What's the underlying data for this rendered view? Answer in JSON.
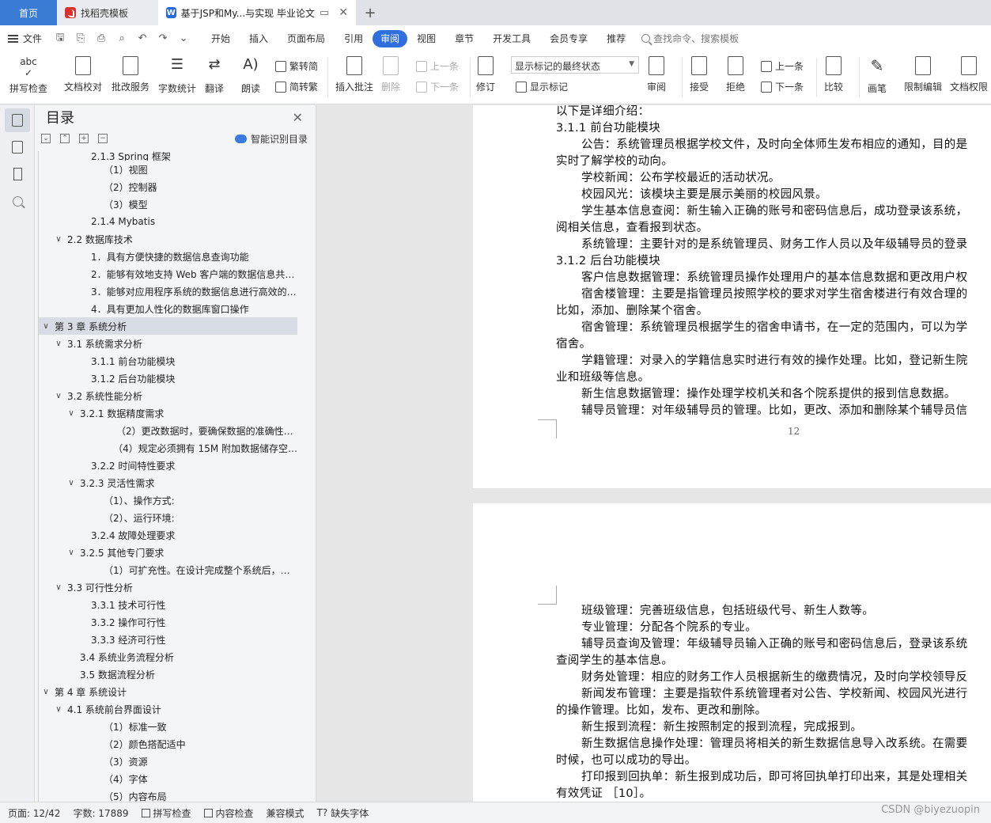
{
  "tabs": {
    "home": "首页",
    "template": "找稻壳模板",
    "document": "基于JSP和My...与实现 毕业论文"
  },
  "menu": {
    "file": "文件",
    "items": [
      "开始",
      "插入",
      "页面布局",
      "引用",
      "审阅",
      "视图",
      "章节",
      "开发工具",
      "会员专享",
      "推荐"
    ],
    "active": "审阅",
    "search": "查找命令、搜索模板"
  },
  "ribbon": {
    "spellcheck": "拼写检查",
    "proofread": "文档校对",
    "batch": "批改服务",
    "wordcount": "字数统计",
    "translate": "翻译",
    "read": "朗读",
    "to_traditional": "繁转简",
    "to_simplified": "简转繁",
    "insert_comment": "插入批注",
    "delete": "删除",
    "prev": "上一条",
    "next": "下一条",
    "revise": "修订",
    "markup_select": "显示标记的最终状态",
    "show_markup": "显示标记",
    "review": "审阅",
    "accept": "接受",
    "reject": "拒绝",
    "prev2": "上一条",
    "next2": "下一条",
    "compare": "比较",
    "pen": "画笔",
    "restrict": "限制编辑",
    "doc_perm": "文档权限"
  },
  "toc": {
    "title": "目录",
    "smart": "智能识别目录",
    "items": [
      {
        "text": "2.1.3 Spring 框架",
        "indent": 4,
        "caret": ""
      },
      {
        "text": "（1）视图",
        "indent": 5,
        "caret": ""
      },
      {
        "text": "（2）控制器",
        "indent": 5,
        "caret": ""
      },
      {
        "text": "（3）模型",
        "indent": 5,
        "caret": ""
      },
      {
        "text": "2.1.4    Mybatis",
        "indent": 4,
        "caret": ""
      },
      {
        "text": "2.2  数据库技术",
        "indent": 2,
        "caret": "v"
      },
      {
        "text": "1．具有方便快捷的数据信息查询功能",
        "indent": 4,
        "caret": ""
      },
      {
        "text": "2．能够有效地支持 Web 客户端的数据信息共…",
        "indent": 4,
        "caret": ""
      },
      {
        "text": "3．能够对应用程序系统的数据信息进行高效的…",
        "indent": 4,
        "caret": ""
      },
      {
        "text": "4．具有更加人性化的数据库窗口操作",
        "indent": 4,
        "caret": ""
      },
      {
        "text": "第 3 章    系统分析",
        "indent": 1,
        "caret": "v",
        "sel": true
      },
      {
        "text": "3.1  系统需求分析",
        "indent": 2,
        "caret": "v"
      },
      {
        "text": "3.1.1 前台功能模块",
        "indent": 4,
        "caret": ""
      },
      {
        "text": "3.1.2 后台功能模块",
        "indent": 4,
        "caret": ""
      },
      {
        "text": "3.2  系统性能分析",
        "indent": 2,
        "caret": "v"
      },
      {
        "text": "3.2.1 数据精度需求",
        "indent": 3,
        "caret": "v"
      },
      {
        "text": "（2）更改数据时，要确保数据的准确性…",
        "indent": 6,
        "caret": ""
      },
      {
        "text": "（4）规定必须拥有 15M 附加数据储存空…",
        "indent": 6,
        "caret": ""
      },
      {
        "text": "3.2.2 时间特性要求",
        "indent": 4,
        "caret": ""
      },
      {
        "text": "3.2.3 灵活性需求",
        "indent": 3,
        "caret": "v"
      },
      {
        "text": "（1）、操作方式:",
        "indent": 5,
        "caret": ""
      },
      {
        "text": "（2）、运行环境:",
        "indent": 5,
        "caret": ""
      },
      {
        "text": "3.2.4 故障处理要求",
        "indent": 4,
        "caret": ""
      },
      {
        "text": "3.2.5 其他专门要求",
        "indent": 3,
        "caret": "v"
      },
      {
        "text": "（1）可扩充性。在设计完成整个系统后，…",
        "indent": 5,
        "caret": ""
      },
      {
        "text": "3.3  可行性分析",
        "indent": 2,
        "caret": "v"
      },
      {
        "text": "3.3.1  技术可行性",
        "indent": 4,
        "caret": ""
      },
      {
        "text": "3.3.2  操作可行性",
        "indent": 4,
        "caret": ""
      },
      {
        "text": "3.3.3  经济可行性",
        "indent": 4,
        "caret": ""
      },
      {
        "text": "3.4 系统业务流程分析",
        "indent": 3,
        "caret": ""
      },
      {
        "text": "3.5 数据流程分析",
        "indent": 3,
        "caret": ""
      },
      {
        "text": "第 4 章    系统设计",
        "indent": 1,
        "caret": "v"
      },
      {
        "text": "4.1  系统前台界面设计",
        "indent": 2,
        "caret": "v"
      },
      {
        "text": "（1）标准一致",
        "indent": 5,
        "caret": ""
      },
      {
        "text": "（2）颜色搭配适中",
        "indent": 5,
        "caret": ""
      },
      {
        "text": "（3）资源",
        "indent": 5,
        "caret": ""
      },
      {
        "text": "（4）字体",
        "indent": 5,
        "caret": ""
      },
      {
        "text": "（5）内容布局",
        "indent": 5,
        "caret": ""
      }
    ]
  },
  "page1": {
    "lines": [
      {
        "t": "以下是详细介绍：",
        "ind": false
      },
      {
        "t": "3.1.1 前台功能模块",
        "ind": false
      },
      {
        "t": "公告：系统管理员根据学校文件，及时向全体师生发布相应的通知，目的是",
        "ind": true
      },
      {
        "t": "实时了解学校的动向。",
        "ind": false
      },
      {
        "t": "学校新闻：公布学校最近的活动状况。",
        "ind": true
      },
      {
        "t": "校园风光：该模块主要是展示美丽的校园风景。",
        "ind": true
      },
      {
        "t": "学生基本信息查阅：新生输入正确的账号和密码信息后，成功登录该系统，",
        "ind": true
      },
      {
        "t": "阅相关信息，查看报到状态。",
        "ind": false
      },
      {
        "t": "系统管理：主要针对的是系统管理员、财务工作人员以及年级辅导员的登录",
        "ind": true
      },
      {
        "t": "3.1.2 后台功能模块",
        "ind": false
      },
      {
        "t": "客户信息数据管理：系统管理员操作处理用户的基本信息数据和更改用户权",
        "ind": true
      },
      {
        "t": "宿舍楼管理：主要是指管理员按照学校的要求对学生宿舍楼进行有效合理的",
        "ind": true
      },
      {
        "t": "比如，添加、删除某个宿舍。",
        "ind": false
      },
      {
        "t": "宿舍管理：系统管理员根据学生的宿舍申请书，在一定的范围内，可以为学",
        "ind": true
      },
      {
        "t": "宿舍。",
        "ind": false
      },
      {
        "t": "学籍管理：对录入的学籍信息实时进行有效的操作处理。比如，登记新生院",
        "ind": true
      },
      {
        "t": "业和班级等信息。",
        "ind": false
      },
      {
        "t": "新生信息数据管理：操作处理学校机关和各个院系提供的报到信息数据。",
        "ind": true
      },
      {
        "t": "辅导员管理：对年级辅导员的管理。比如，更改、添加和删除某个辅导员信",
        "ind": true
      }
    ],
    "page_number": "12"
  },
  "page2": {
    "lines": [
      {
        "t": "班级管理：完善班级信息，包括班级代号、新生人数等。",
        "ind": true
      },
      {
        "t": "专业管理：分配各个院系的专业。",
        "ind": true
      },
      {
        "t": "辅导员查询及管理：年级辅导员输入正确的账号和密码信息后，登录该系统",
        "ind": true
      },
      {
        "t": "查阅学生的基本信息。",
        "ind": false
      },
      {
        "t": "财务处管理：相应的财务工作人员根据新生的缴费情况，及时向学校领导反",
        "ind": true
      },
      {
        "t": "新闻发布管理：主要是指软件系统管理者对公告、学校新闻、校园风光进行",
        "ind": true
      },
      {
        "t": "的操作管理。比如，发布、更改和删除。",
        "ind": false
      },
      {
        "t": "新生报到流程：新生按照制定的报到流程，完成报到。",
        "ind": true
      },
      {
        "t": "新生数据信息操作处理：管理员将相关的新生数据信息导入改系统。在需要",
        "ind": true
      },
      {
        "t": "时候，也可以成功的导出。",
        "ind": false
      },
      {
        "t": "打印报到回执单：新生报到成功后，即可将回执单打印出来，其是处理相关",
        "ind": true
      },
      {
        "t": "有效凭证 ［10］。",
        "ind": false
      }
    ]
  },
  "status": {
    "page": "页面: 12/42",
    "words": "字数: 17889",
    "spell": "拼写检查",
    "content": "内容检查",
    "compat": "兼容模式",
    "missing_font": "缺失字体"
  },
  "watermark": "CSDN @biyezuopin",
  "colors": {
    "accent": "#2f6fde",
    "home_tab": "#3a7bd5"
  }
}
